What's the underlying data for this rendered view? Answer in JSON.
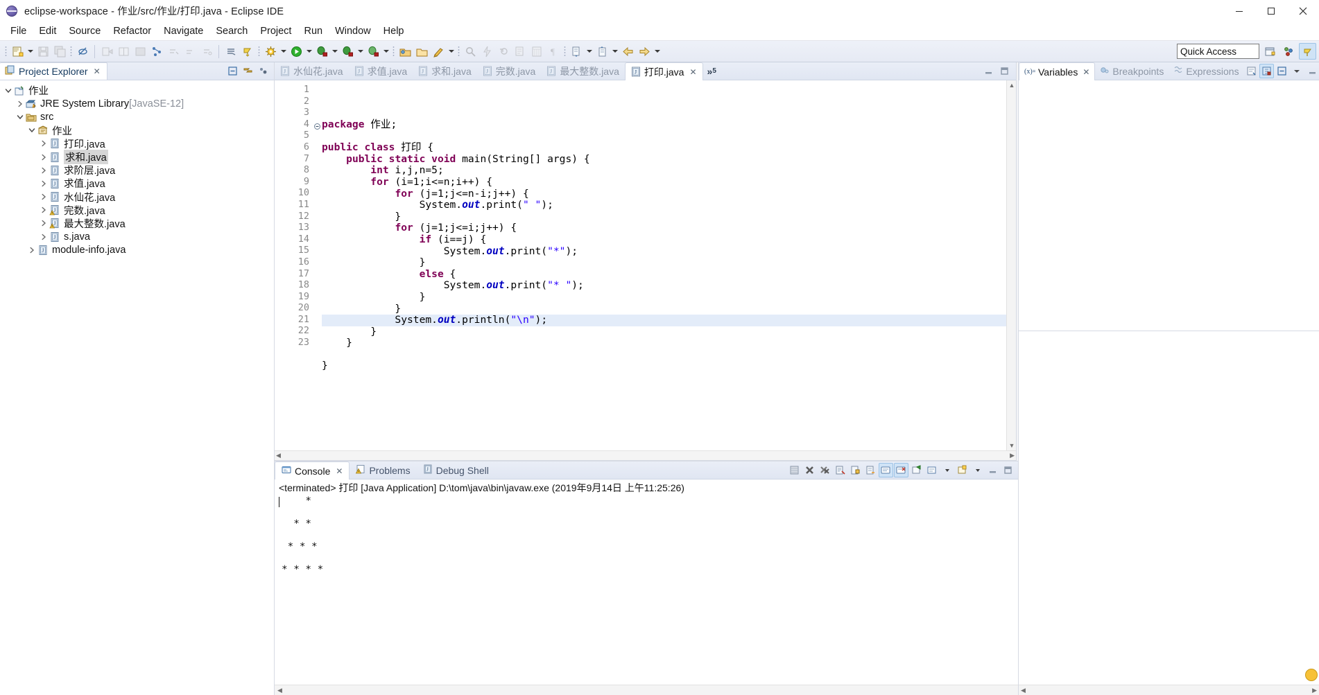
{
  "window": {
    "title": "eclipse-workspace - 作业/src/作业/打印.java - Eclipse IDE",
    "app_icon": "eclipse-globe-icon",
    "controls": {
      "minimize": "minimize-icon",
      "maximize": "maximize-icon",
      "close": "close-icon"
    }
  },
  "menubar": {
    "items": [
      {
        "label": "File"
      },
      {
        "label": "Edit"
      },
      {
        "label": "Source"
      },
      {
        "label": "Refactor"
      },
      {
        "label": "Navigate"
      },
      {
        "label": "Search"
      },
      {
        "label": "Project"
      },
      {
        "label": "Run"
      },
      {
        "label": "Window"
      },
      {
        "label": "Help"
      }
    ]
  },
  "toolbar": {
    "quick_access_placeholder": "Quick Access",
    "quick_access_value": "",
    "groups": [
      {
        "buttons": [
          "new-wizard-icon",
          "new-dropdown-arrow",
          "save-icon",
          "save-all-icon"
        ]
      },
      {
        "buttons": [
          "toggle-breadcrumb-icon"
        ]
      },
      {
        "buttons": [
          "run-last-tool-icon",
          "open-type-icon",
          "open-task-icon",
          "link-icon",
          "next-annotation-icon",
          "previous-annotation-icon",
          "last-edit-icon"
        ]
      },
      {
        "buttons": [
          "skip-breakpoints-icon",
          "debug-mode-icon"
        ]
      },
      {
        "buttons": [
          "external-tools-icon",
          "external-dropdown-arrow",
          "run-icon",
          "run-dropdown-arrow",
          "debug-icon",
          "debug-dropdown-arrow",
          "coverage-icon",
          "coverage-dropdown-arrow",
          "profile-icon",
          "profile-dropdown-arrow"
        ]
      },
      {
        "buttons": [
          "new-java-project-icon",
          "new-package-icon",
          "new-class-icon",
          "new-class-dropdown-arrow"
        ]
      },
      {
        "buttons": [
          "search-icon",
          "quick-fix-icon",
          "refactor-icon",
          "open-declaration-icon",
          "show-view-icon",
          "pilcrow-icon"
        ]
      },
      {
        "buttons": [
          "next-edit-icon",
          "next-edit-arrow",
          "previous-edit-icon",
          "previous-edit-arrow",
          "back-icon",
          "forward-icon",
          "forward-arrow"
        ]
      }
    ],
    "perspective_buttons": [
      "open-perspective-icon",
      "java-perspective-icon",
      "debug-perspective-icon"
    ]
  },
  "explorer": {
    "tab_label": "Project Explorer",
    "tab_icon": "project-explorer-icon",
    "tab_close": "✕",
    "tools": [
      "collapse-all-icon",
      "link-with-editor-icon",
      "view-menu-icon"
    ],
    "tree": [
      {
        "indent": 0,
        "twisty": "down",
        "icon": "java-project-icon",
        "label": "作业",
        "sub": "",
        "selected": false
      },
      {
        "indent": 1,
        "twisty": "right",
        "icon": "jre-library-icon",
        "label": "JRE System Library",
        "sub": "[JavaSE-12]",
        "selected": false
      },
      {
        "indent": 1,
        "twisty": "down",
        "icon": "source-folder-icon",
        "label": "src",
        "sub": "",
        "selected": false
      },
      {
        "indent": 2,
        "twisty": "down",
        "icon": "package-icon",
        "label": "作业",
        "sub": "",
        "selected": false
      },
      {
        "indent": 3,
        "twisty": "right",
        "icon": "java-file-icon",
        "label": "打印.java",
        "sub": "",
        "selected": false
      },
      {
        "indent": 3,
        "twisty": "right",
        "icon": "java-file-icon",
        "label": "求和.java",
        "sub": "",
        "selected": true
      },
      {
        "indent": 3,
        "twisty": "right",
        "icon": "java-file-icon",
        "label": "求阶层.java",
        "sub": "",
        "selected": false
      },
      {
        "indent": 3,
        "twisty": "right",
        "icon": "java-file-icon",
        "label": "求值.java",
        "sub": "",
        "selected": false
      },
      {
        "indent": 3,
        "twisty": "right",
        "icon": "java-file-icon",
        "label": "水仙花.java",
        "sub": "",
        "selected": false
      },
      {
        "indent": 3,
        "twisty": "right",
        "icon": "java-file-warning-icon",
        "label": "完数.java",
        "sub": "",
        "selected": false
      },
      {
        "indent": 3,
        "twisty": "right",
        "icon": "java-file-warning-icon",
        "label": "最大整数.java",
        "sub": "",
        "selected": false
      },
      {
        "indent": 3,
        "twisty": "right",
        "icon": "java-file-icon",
        "label": "s.java",
        "sub": "",
        "selected": false
      },
      {
        "indent": 2,
        "twisty": "right",
        "icon": "java-file-icon",
        "label": "module-info.java",
        "sub": "",
        "selected": false
      }
    ]
  },
  "editor": {
    "tabs": [
      {
        "label": "水仙花.java",
        "active": false
      },
      {
        "label": "求值.java",
        "active": false
      },
      {
        "label": "求和.java",
        "active": false
      },
      {
        "label": "完数.java",
        "active": false
      },
      {
        "label": "最大整数.java",
        "active": false
      },
      {
        "label": "打印.java",
        "active": true
      }
    ],
    "overflow_label": "»",
    "overflow_count": "5",
    "tools": [
      "minimize-view-icon",
      "maximize-view-icon"
    ],
    "highlight_line": 18,
    "fold_marker_line": 4,
    "lines": [
      {
        "n": 1,
        "tokens": [
          {
            "t": "kw",
            "v": "package"
          },
          {
            "t": "p",
            "v": " 作业;"
          }
        ]
      },
      {
        "n": 2,
        "tokens": []
      },
      {
        "n": 3,
        "tokens": [
          {
            "t": "kw",
            "v": "public class"
          },
          {
            "t": "p",
            "v": " 打印 {"
          }
        ]
      },
      {
        "n": 4,
        "tokens": [
          {
            "t": "p",
            "v": "    "
          },
          {
            "t": "kw",
            "v": "public static void"
          },
          {
            "t": "p",
            "v": " main(String[] args) {"
          }
        ]
      },
      {
        "n": 5,
        "tokens": [
          {
            "t": "p",
            "v": "        "
          },
          {
            "t": "kw",
            "v": "int"
          },
          {
            "t": "p",
            "v": " i,j,n=5;"
          }
        ]
      },
      {
        "n": 6,
        "tokens": [
          {
            "t": "p",
            "v": "        "
          },
          {
            "t": "kw",
            "v": "for"
          },
          {
            "t": "p",
            "v": " (i=1;i<=n;i++) {"
          }
        ]
      },
      {
        "n": 7,
        "tokens": [
          {
            "t": "p",
            "v": "            "
          },
          {
            "t": "kw",
            "v": "for"
          },
          {
            "t": "p",
            "v": " (j=1;j<=n-i;j++) {"
          }
        ]
      },
      {
        "n": 8,
        "tokens": [
          {
            "t": "p",
            "v": "                System."
          },
          {
            "t": "fld",
            "v": "out"
          },
          {
            "t": "p",
            "v": ".print("
          },
          {
            "t": "str",
            "v": "\" \""
          },
          {
            "t": "p",
            "v": ");"
          }
        ]
      },
      {
        "n": 9,
        "tokens": [
          {
            "t": "p",
            "v": "            }"
          }
        ]
      },
      {
        "n": 10,
        "tokens": [
          {
            "t": "p",
            "v": "            "
          },
          {
            "t": "kw",
            "v": "for"
          },
          {
            "t": "p",
            "v": " (j=1;j<=i;j++) {"
          }
        ]
      },
      {
        "n": 11,
        "tokens": [
          {
            "t": "p",
            "v": "                "
          },
          {
            "t": "kw",
            "v": "if"
          },
          {
            "t": "p",
            "v": " (i==j) {"
          }
        ]
      },
      {
        "n": 12,
        "tokens": [
          {
            "t": "p",
            "v": "                    System."
          },
          {
            "t": "fld",
            "v": "out"
          },
          {
            "t": "p",
            "v": ".print("
          },
          {
            "t": "str",
            "v": "\"*\""
          },
          {
            "t": "p",
            "v": ");"
          }
        ]
      },
      {
        "n": 13,
        "tokens": [
          {
            "t": "p",
            "v": "                }"
          }
        ]
      },
      {
        "n": 14,
        "tokens": [
          {
            "t": "p",
            "v": "                "
          },
          {
            "t": "kw",
            "v": "else"
          },
          {
            "t": "p",
            "v": " {"
          }
        ]
      },
      {
        "n": 15,
        "tokens": [
          {
            "t": "p",
            "v": "                    System."
          },
          {
            "t": "fld",
            "v": "out"
          },
          {
            "t": "p",
            "v": ".print("
          },
          {
            "t": "str",
            "v": "\"* \""
          },
          {
            "t": "p",
            "v": ");"
          }
        ]
      },
      {
        "n": 16,
        "tokens": [
          {
            "t": "p",
            "v": "                }"
          }
        ]
      },
      {
        "n": 17,
        "tokens": [
          {
            "t": "p",
            "v": "            }"
          }
        ]
      },
      {
        "n": 18,
        "tokens": [
          {
            "t": "p",
            "v": "            System."
          },
          {
            "t": "fld",
            "v": "out"
          },
          {
            "t": "p",
            "v": ".println("
          },
          {
            "t": "str",
            "v": "\"\\n\""
          },
          {
            "t": "p",
            "v": ");"
          }
        ]
      },
      {
        "n": 19,
        "tokens": [
          {
            "t": "p",
            "v": "        }"
          }
        ]
      },
      {
        "n": 20,
        "tokens": [
          {
            "t": "p",
            "v": "    }"
          }
        ]
      },
      {
        "n": 21,
        "tokens": []
      },
      {
        "n": 22,
        "tokens": [
          {
            "t": "p",
            "v": "}"
          }
        ]
      },
      {
        "n": 23,
        "tokens": []
      }
    ]
  },
  "console": {
    "tabs": [
      {
        "label": "Console",
        "icon": "console-icon",
        "active": true,
        "close": "✕"
      },
      {
        "label": "Problems",
        "icon": "problems-icon",
        "active": false
      },
      {
        "label": "Debug Shell",
        "icon": "debug-shell-icon",
        "active": false
      }
    ],
    "tools": [
      "clear-console-icon",
      "terminate-icon",
      "remove-all-terminated-icon",
      "scroll-lock-icon",
      "lock-console-icon",
      "word-wrap-icon",
      "show-console-icon",
      "display-selected-console-icon",
      "pin-console-icon",
      "open-console-icon",
      "open-console-arrow",
      "minimize-console-icon",
      "maximize-console-icon"
    ],
    "terminated_line": "<terminated> 打印 [Java Application] D:\\tom\\java\\bin\\javaw.exe (2019年9月14日 上午11:25:26)",
    "output": "    *\n\n  * *\n\n * * *\n\n* * * *"
  },
  "variables": {
    "tabs": [
      {
        "label": "Variables",
        "icon": "variables-icon",
        "active": true,
        "close": "✕"
      },
      {
        "label": "Breakpoints",
        "icon": "breakpoints-icon",
        "active": false
      },
      {
        "label": "Expressions",
        "icon": "expressions-icon",
        "active": false
      }
    ],
    "tools": [
      "collapse-all-icon",
      "show-logical-structure-icon",
      "collapse-icon",
      "view-menu-icon",
      "minimize-icon",
      "maximize-icon"
    ],
    "rows": []
  },
  "colors": {
    "accent": "#2a00ff",
    "keyword": "#7f0055",
    "field": "#0000c0",
    "selection": "#d6d6d6",
    "current_line": "#e3ecf9",
    "chrome": "#e6eaf4"
  }
}
